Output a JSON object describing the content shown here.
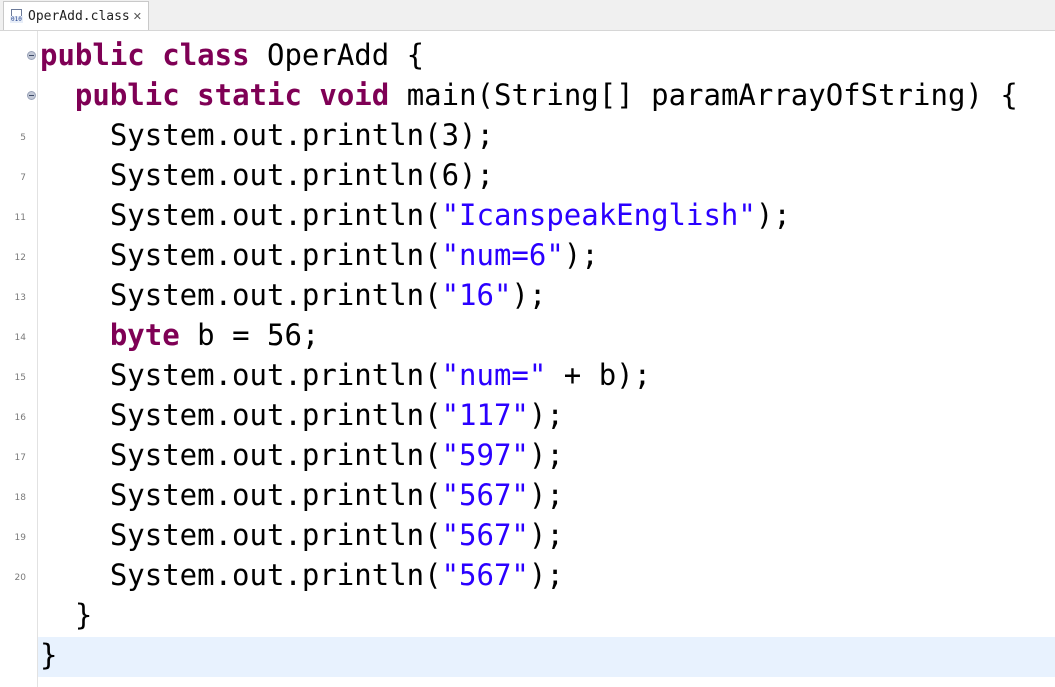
{
  "tab": {
    "label": "OperAdd.class",
    "icon": "class-file-icon",
    "close_glyph": "✕"
  },
  "colors": {
    "keyword": "#7f0055",
    "string": "#2a00ff",
    "text": "#000000",
    "current_line": "#e8f2fe"
  },
  "lines": [
    {
      "no": "",
      "fold": true,
      "parts": [
        {
          "t": "public",
          "c": "kw"
        },
        {
          "t": " ",
          "c": "plain"
        },
        {
          "t": "class",
          "c": "kw"
        },
        {
          "t": " OperAdd {",
          "c": "plain"
        }
      ]
    },
    {
      "no": "",
      "fold": true,
      "parts": [
        {
          "t": "  ",
          "c": "plain"
        },
        {
          "t": "public",
          "c": "kw"
        },
        {
          "t": " ",
          "c": "plain"
        },
        {
          "t": "static",
          "c": "kw"
        },
        {
          "t": " ",
          "c": "plain"
        },
        {
          "t": "void",
          "c": "kw"
        },
        {
          "t": " main(String[] paramArrayOfString) {",
          "c": "plain"
        }
      ]
    },
    {
      "no": "5",
      "fold": false,
      "parts": [
        {
          "t": "    System.out.println(3);",
          "c": "plain"
        }
      ]
    },
    {
      "no": "7",
      "fold": false,
      "parts": [
        {
          "t": "    System.out.println(6);",
          "c": "plain"
        }
      ]
    },
    {
      "no": "11",
      "fold": false,
      "parts": [
        {
          "t": "    System.out.println(",
          "c": "plain"
        },
        {
          "t": "\"IcanspeakEnglish\"",
          "c": "str"
        },
        {
          "t": ");",
          "c": "plain"
        }
      ]
    },
    {
      "no": "12",
      "fold": false,
      "parts": [
        {
          "t": "    System.out.println(",
          "c": "plain"
        },
        {
          "t": "\"num=6\"",
          "c": "str"
        },
        {
          "t": ");",
          "c": "plain"
        }
      ]
    },
    {
      "no": "13",
      "fold": false,
      "parts": [
        {
          "t": "    System.out.println(",
          "c": "plain"
        },
        {
          "t": "\"16\"",
          "c": "str"
        },
        {
          "t": ");",
          "c": "plain"
        }
      ]
    },
    {
      "no": "14",
      "fold": false,
      "parts": [
        {
          "t": "    ",
          "c": "plain"
        },
        {
          "t": "byte",
          "c": "kw"
        },
        {
          "t": " b = 56;",
          "c": "plain"
        }
      ]
    },
    {
      "no": "15",
      "fold": false,
      "parts": [
        {
          "t": "    System.out.println(",
          "c": "plain"
        },
        {
          "t": "\"num=\"",
          "c": "str"
        },
        {
          "t": " + b);",
          "c": "plain"
        }
      ]
    },
    {
      "no": "16",
      "fold": false,
      "parts": [
        {
          "t": "    System.out.println(",
          "c": "plain"
        },
        {
          "t": "\"117\"",
          "c": "str"
        },
        {
          "t": ");",
          "c": "plain"
        }
      ]
    },
    {
      "no": "17",
      "fold": false,
      "parts": [
        {
          "t": "    System.out.println(",
          "c": "plain"
        },
        {
          "t": "\"597\"",
          "c": "str"
        },
        {
          "t": ");",
          "c": "plain"
        }
      ]
    },
    {
      "no": "18",
      "fold": false,
      "parts": [
        {
          "t": "    System.out.println(",
          "c": "plain"
        },
        {
          "t": "\"567\"",
          "c": "str"
        },
        {
          "t": ");",
          "c": "plain"
        }
      ]
    },
    {
      "no": "19",
      "fold": false,
      "parts": [
        {
          "t": "    System.out.println(",
          "c": "plain"
        },
        {
          "t": "\"567\"",
          "c": "str"
        },
        {
          "t": ");",
          "c": "plain"
        }
      ]
    },
    {
      "no": "20",
      "fold": false,
      "parts": [
        {
          "t": "    System.out.println(",
          "c": "plain"
        },
        {
          "t": "\"567\"",
          "c": "str"
        },
        {
          "t": ");",
          "c": "plain"
        }
      ]
    },
    {
      "no": "",
      "fold": false,
      "parts": [
        {
          "t": "  }",
          "c": "plain"
        }
      ]
    },
    {
      "no": "",
      "fold": false,
      "current": true,
      "parts": [
        {
          "t": "}",
          "c": "plain"
        }
      ]
    }
  ]
}
